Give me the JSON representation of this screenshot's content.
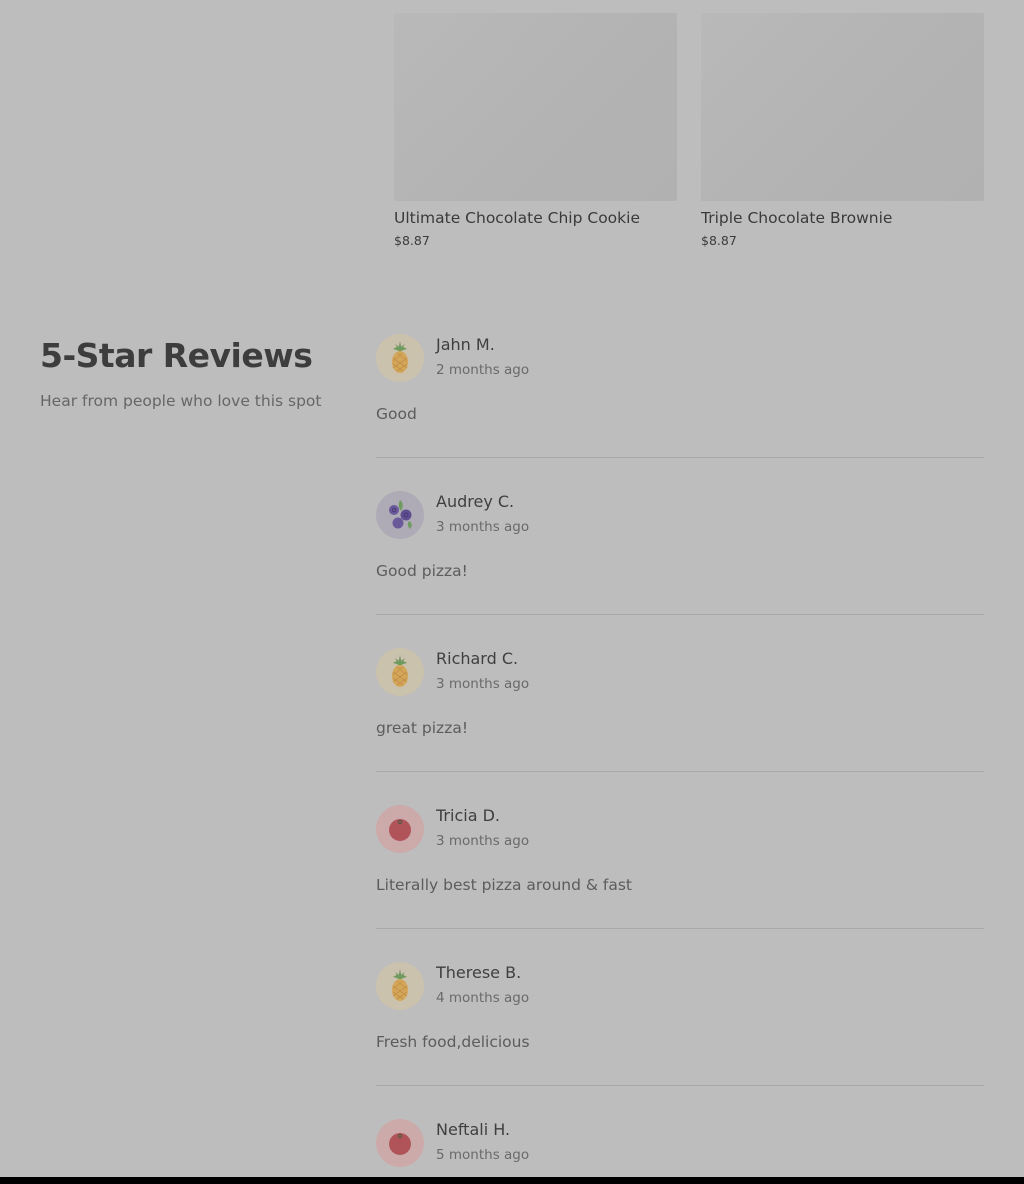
{
  "products": [
    {
      "name": "Ultimate Chocolate Chip Cookie",
      "price": "$8.87"
    },
    {
      "name": "Triple Chocolate Brownie",
      "price": "$8.87"
    }
  ],
  "reviews_section": {
    "title": "5-Star Reviews",
    "subtitle": "Hear from people who love this spot"
  },
  "reviews": [
    {
      "name": "Jahn M.",
      "date": "2 months ago",
      "text": "Good",
      "avatar_icon": "pineapple-icon"
    },
    {
      "name": "Audrey C.",
      "date": "3 months ago",
      "text": "Good pizza!",
      "avatar_icon": "blueberry-icon"
    },
    {
      "name": "Richard C.",
      "date": "3 months ago",
      "text": "great pizza!",
      "avatar_icon": "pineapple-icon"
    },
    {
      "name": "Tricia D.",
      "date": "3 months ago",
      "text": "Literally best pizza around & fast",
      "avatar_icon": "tomato-icon"
    },
    {
      "name": "Therese B.",
      "date": "4 months ago",
      "text": "Fresh food,delicious",
      "avatar_icon": "pineapple-icon"
    },
    {
      "name": "Neftali H.",
      "date": "5 months ago",
      "text": "",
      "avatar_icon": "tomato-icon"
    }
  ]
}
